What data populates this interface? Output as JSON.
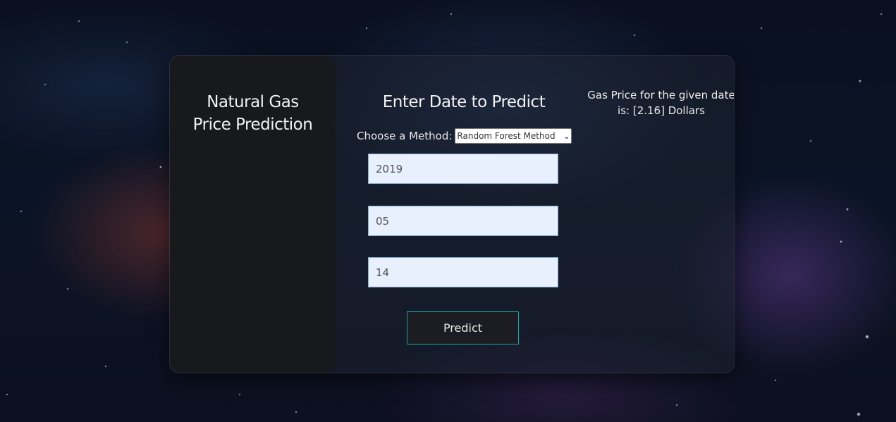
{
  "sidebar": {
    "title_line1": "Natural Gas",
    "title_line2": "Price Prediction"
  },
  "form": {
    "title": "Enter Date to Predict",
    "method_label": "Choose a Method:",
    "method_selected": "Random Forest Method",
    "year_value": "2019",
    "month_value": "05",
    "day_value": "14",
    "predict_label": "Predict"
  },
  "result": {
    "text": "Gas Price for the given date is: [2.16] Dollars"
  },
  "colors": {
    "side_panel": "#18191d",
    "input_bg": "#e8f0fe",
    "button_border": "#1aa3a6"
  }
}
